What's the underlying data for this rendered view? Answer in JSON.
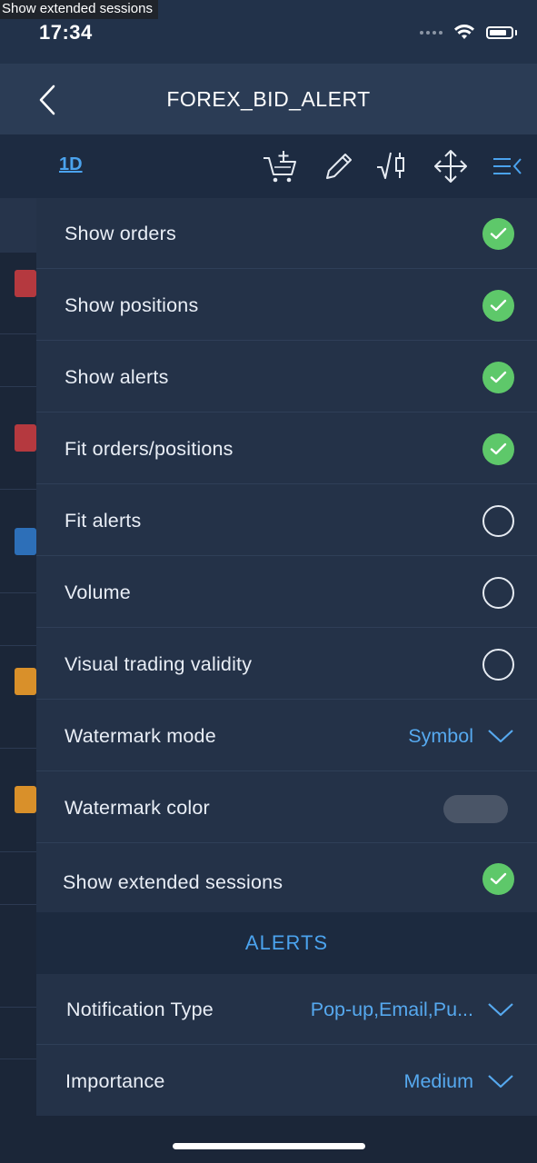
{
  "tooltip": "Show extended sessions",
  "status_bar": {
    "time": "17:34"
  },
  "nav": {
    "title": "FOREX_BID_ALERT",
    "back_icon": "chevron-left-icon"
  },
  "toolbar": {
    "timeframe": "1D",
    "tools": [
      "cart-add-icon",
      "pencil-icon",
      "indicator-icon",
      "move-icon",
      "menu-collapse-icon"
    ]
  },
  "settings": [
    {
      "label": "Show orders",
      "control": "check",
      "checked": true
    },
    {
      "label": "Show positions",
      "control": "check",
      "checked": true
    },
    {
      "label": "Show alerts",
      "control": "check",
      "checked": true
    },
    {
      "label": "Fit orders/positions",
      "control": "check",
      "checked": true
    },
    {
      "label": "Fit alerts",
      "control": "check",
      "checked": false
    },
    {
      "label": "Volume",
      "control": "check",
      "checked": false
    },
    {
      "label": "Visual trading validity",
      "control": "check",
      "checked": false
    },
    {
      "label": "Watermark mode",
      "control": "dropdown",
      "value": "Symbol"
    },
    {
      "label": "Watermark color",
      "control": "color",
      "color": "#4a5567"
    },
    {
      "label": "Show extended sessions",
      "control": "check",
      "checked": true
    }
  ],
  "alerts_section": {
    "title": "ALERTS",
    "rows": [
      {
        "label": "Notification Type",
        "value": "Pop-up,Email,Pu..."
      },
      {
        "label": "Importance",
        "value": "Medium"
      }
    ]
  },
  "colors": {
    "accent": "#4ba3ee",
    "check_green": "#5ec86a",
    "panel_bg": "#243248",
    "nav_bg": "#2b3c55"
  }
}
